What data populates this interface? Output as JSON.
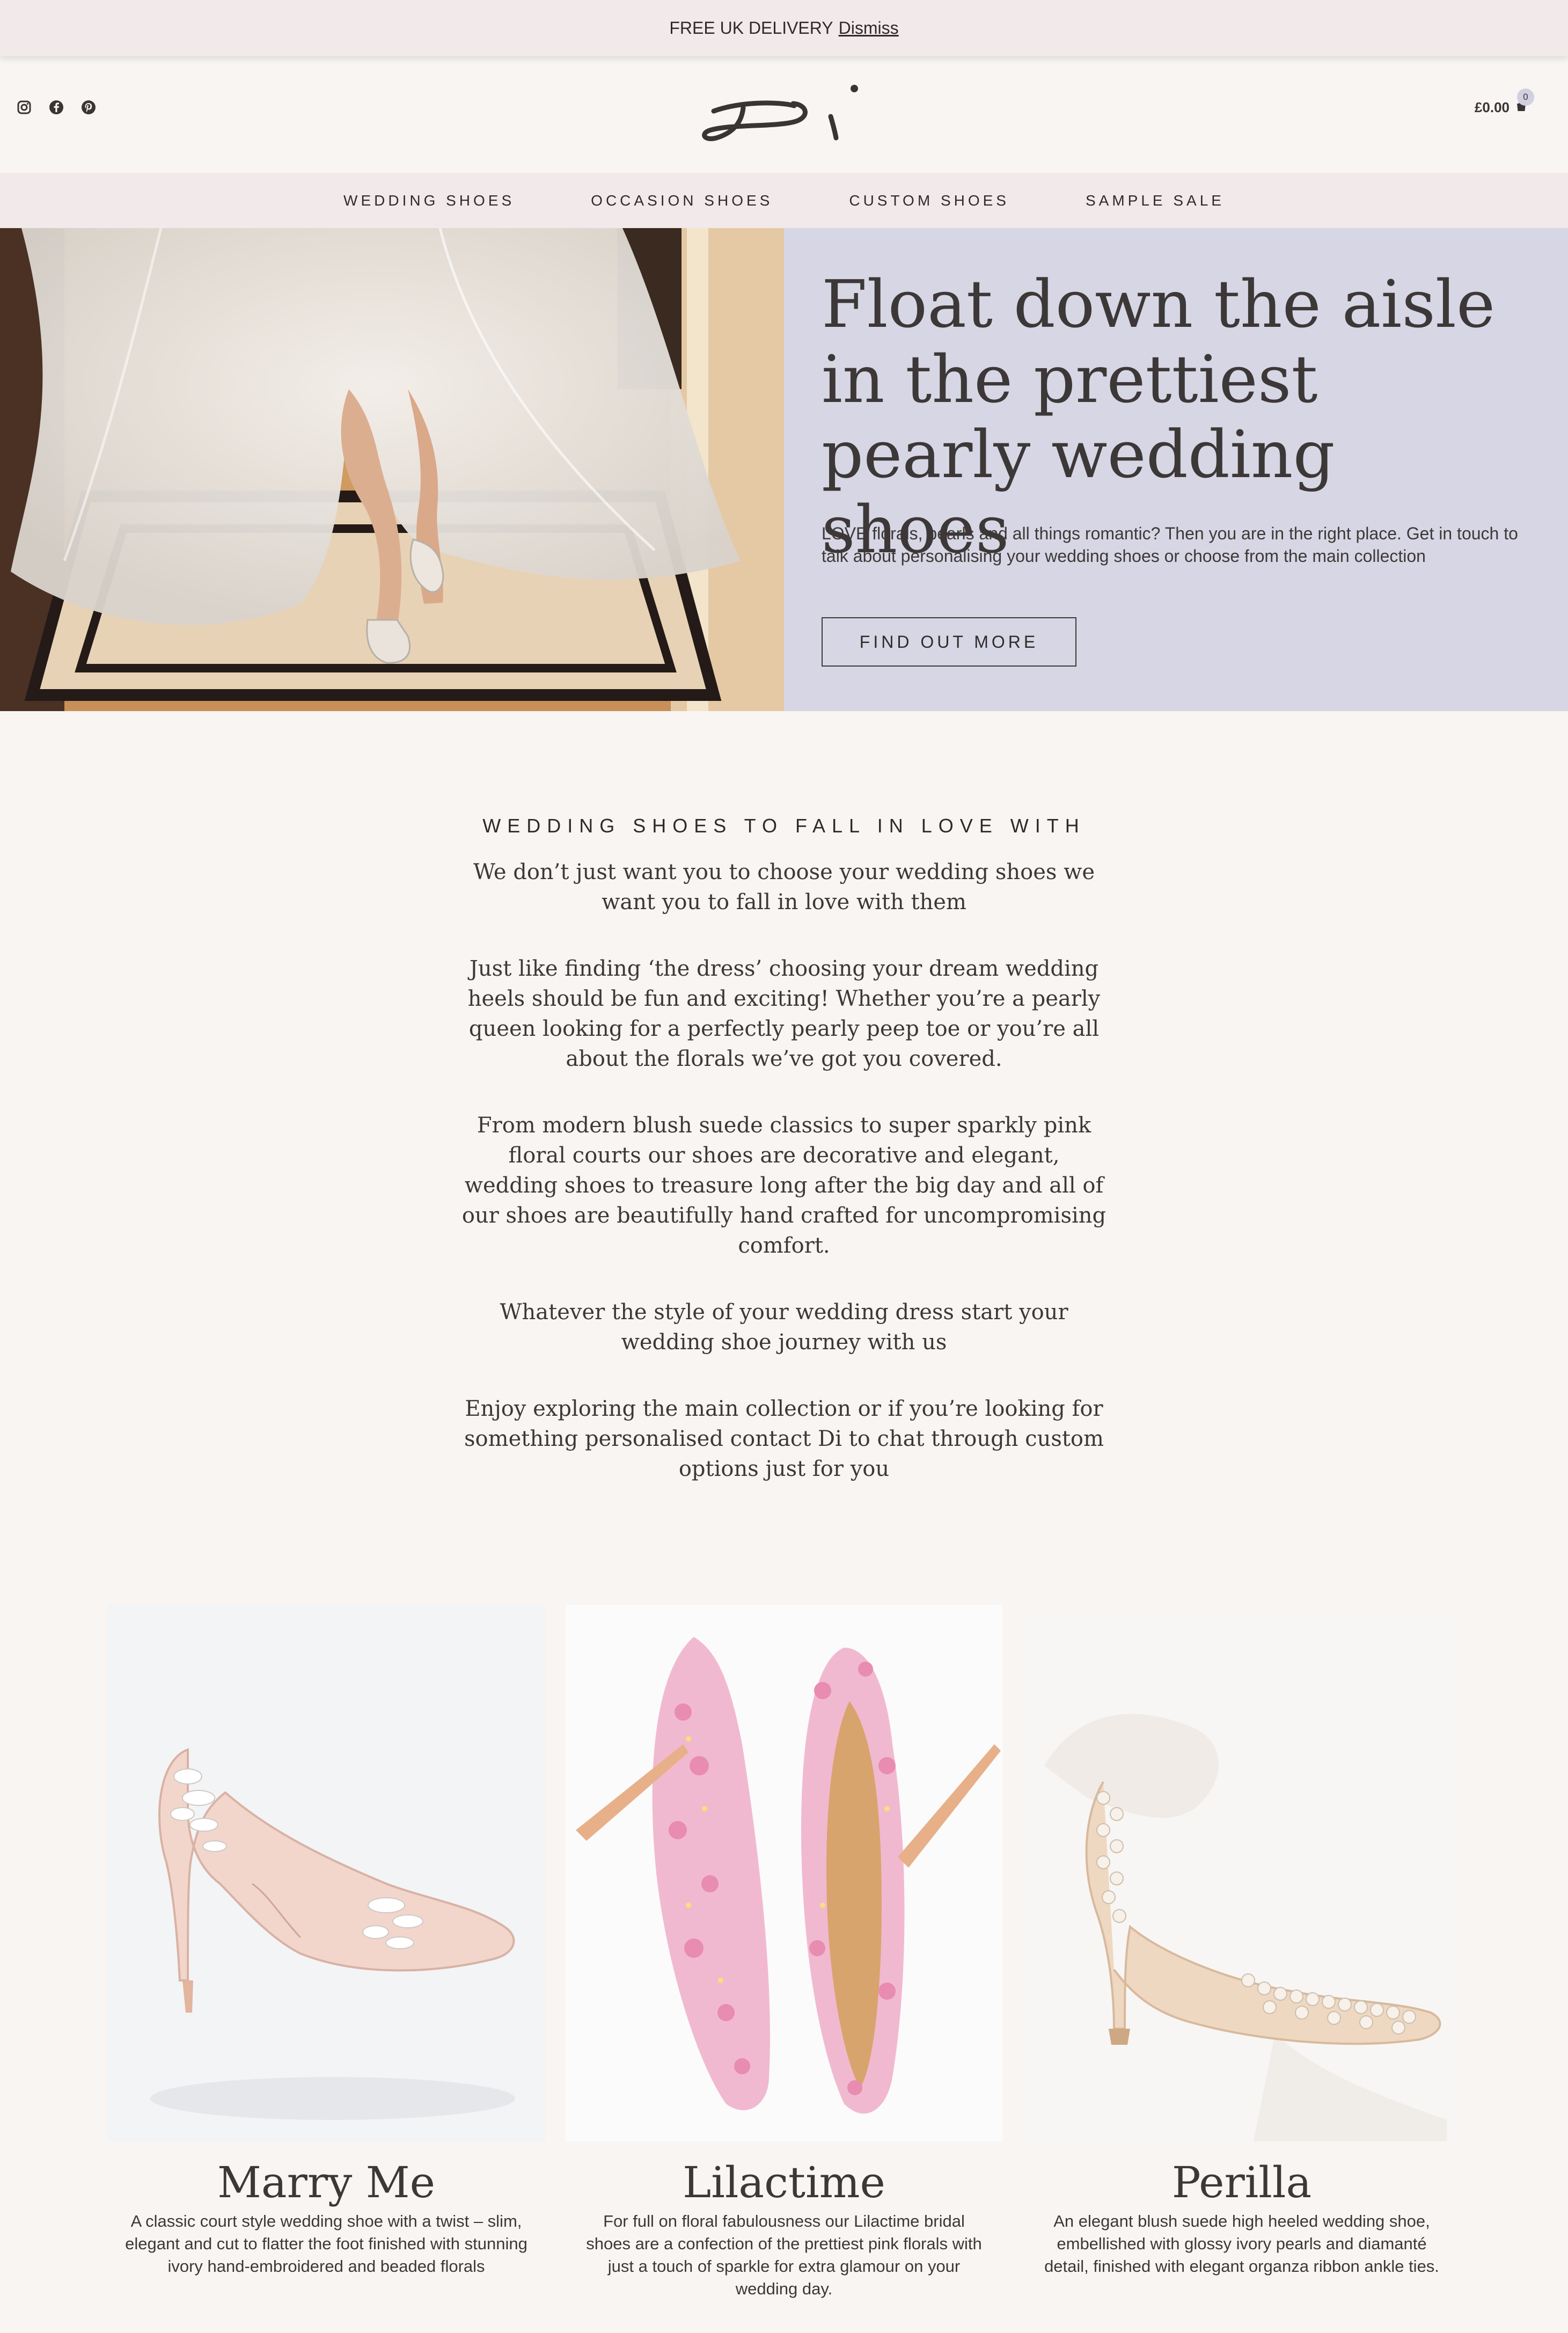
{
  "promo": {
    "text": "FREE UK DELIVERY",
    "dismiss": "Dismiss"
  },
  "header": {
    "social": [
      "instagram-icon",
      "facebook-icon",
      "pinterest-icon"
    ],
    "cart_total": "£0.00",
    "cart_count": "0"
  },
  "nav": {
    "items": [
      {
        "label": "WEDDING SHOES"
      },
      {
        "label": "OCCASION SHOES"
      },
      {
        "label": "CUSTOM SHOES"
      },
      {
        "label": "SAMPLE SALE"
      }
    ]
  },
  "hero": {
    "title": "Float down the aisle in the prettiest pearly wedding shoes",
    "description": "LOVE florals, pearls and all things romantic? Then you are in the right place. Get in touch to talk about personalising your wedding shoes or choose from the main collection",
    "button": "FIND OUT MORE"
  },
  "intro": {
    "heading": "WEDDING SHOES TO FALL IN LOVE WITH",
    "paragraphs": [
      "We don’t just want you to choose your wedding shoes we want you to fall in love with them",
      "Just like finding ‘the dress’ choosing your dream wedding heels should be fun and exciting! Whether you’re a pearly queen looking for a perfectly pearly peep toe or you’re all about the florals we’ve got you covered.",
      "From modern blush suede classics to super sparkly pink floral courts our shoes are decorative and elegant, wedding shoes to treasure long after the big day and all of our shoes are beautifully hand crafted for uncompromising comfort.",
      "Whatever the style of your wedding dress start your wedding shoe journey with us",
      "Enjoy exploring the main collection or if you’re looking for something personalised contact Di to chat through custom options just for you"
    ]
  },
  "products": [
    {
      "name": "Marry Me",
      "description": "A classic court style wedding shoe with a twist – slim, elegant and cut to flatter the foot finished with stunning ivory hand-embroidered and beaded florals"
    },
    {
      "name": "Lilactime",
      "description": "For full on floral fabulousness our Lilactime bridal shoes are a confection of the prettiest pink florals with just a touch of sparkle for extra glamour on your wedding day."
    },
    {
      "name": "Perilla",
      "description": "An elegant blush suede high heeled wedding shoe, embellished with glossy ivory pearls and diamanté detail, finished with elegant organza ribbon ankle ties."
    }
  ],
  "colors": {
    "page_bg": "#f8f5f2",
    "banner_bg": "#f1e9ea",
    "hero_panel": "#d7d6e4",
    "text": "#3d3838"
  }
}
